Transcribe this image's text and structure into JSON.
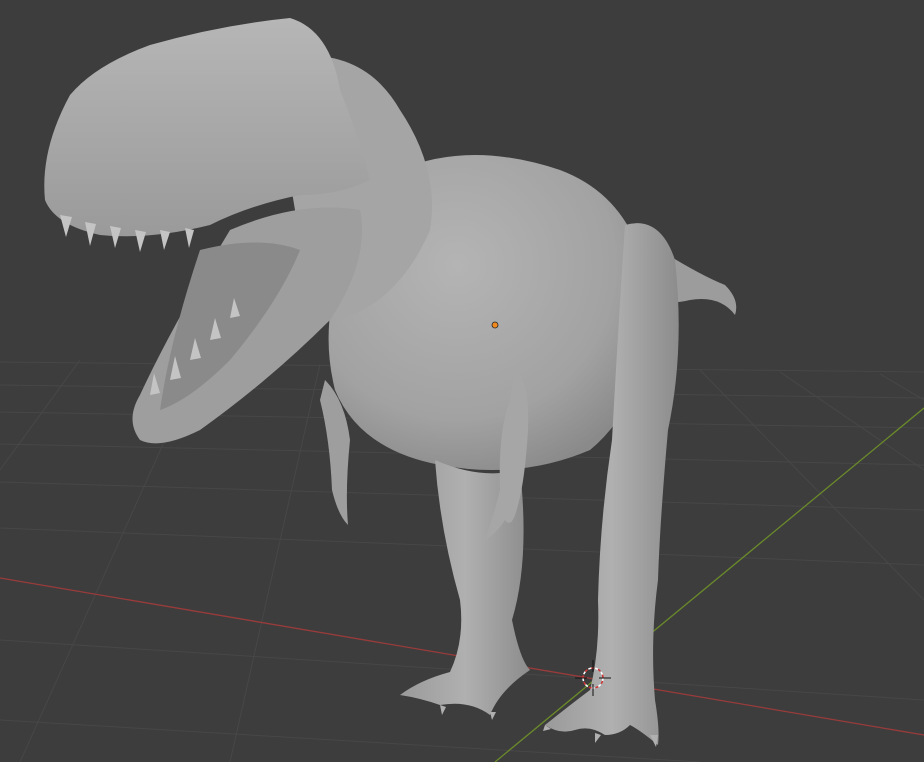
{
  "viewport": {
    "background": "#3d3d3d",
    "grid_color": "#474747",
    "x_axis_color": "#9a3b3b",
    "y_axis_color": "#6a8a2a",
    "model_color": "#a9a9a9",
    "origin_color": "#f08a1c"
  }
}
